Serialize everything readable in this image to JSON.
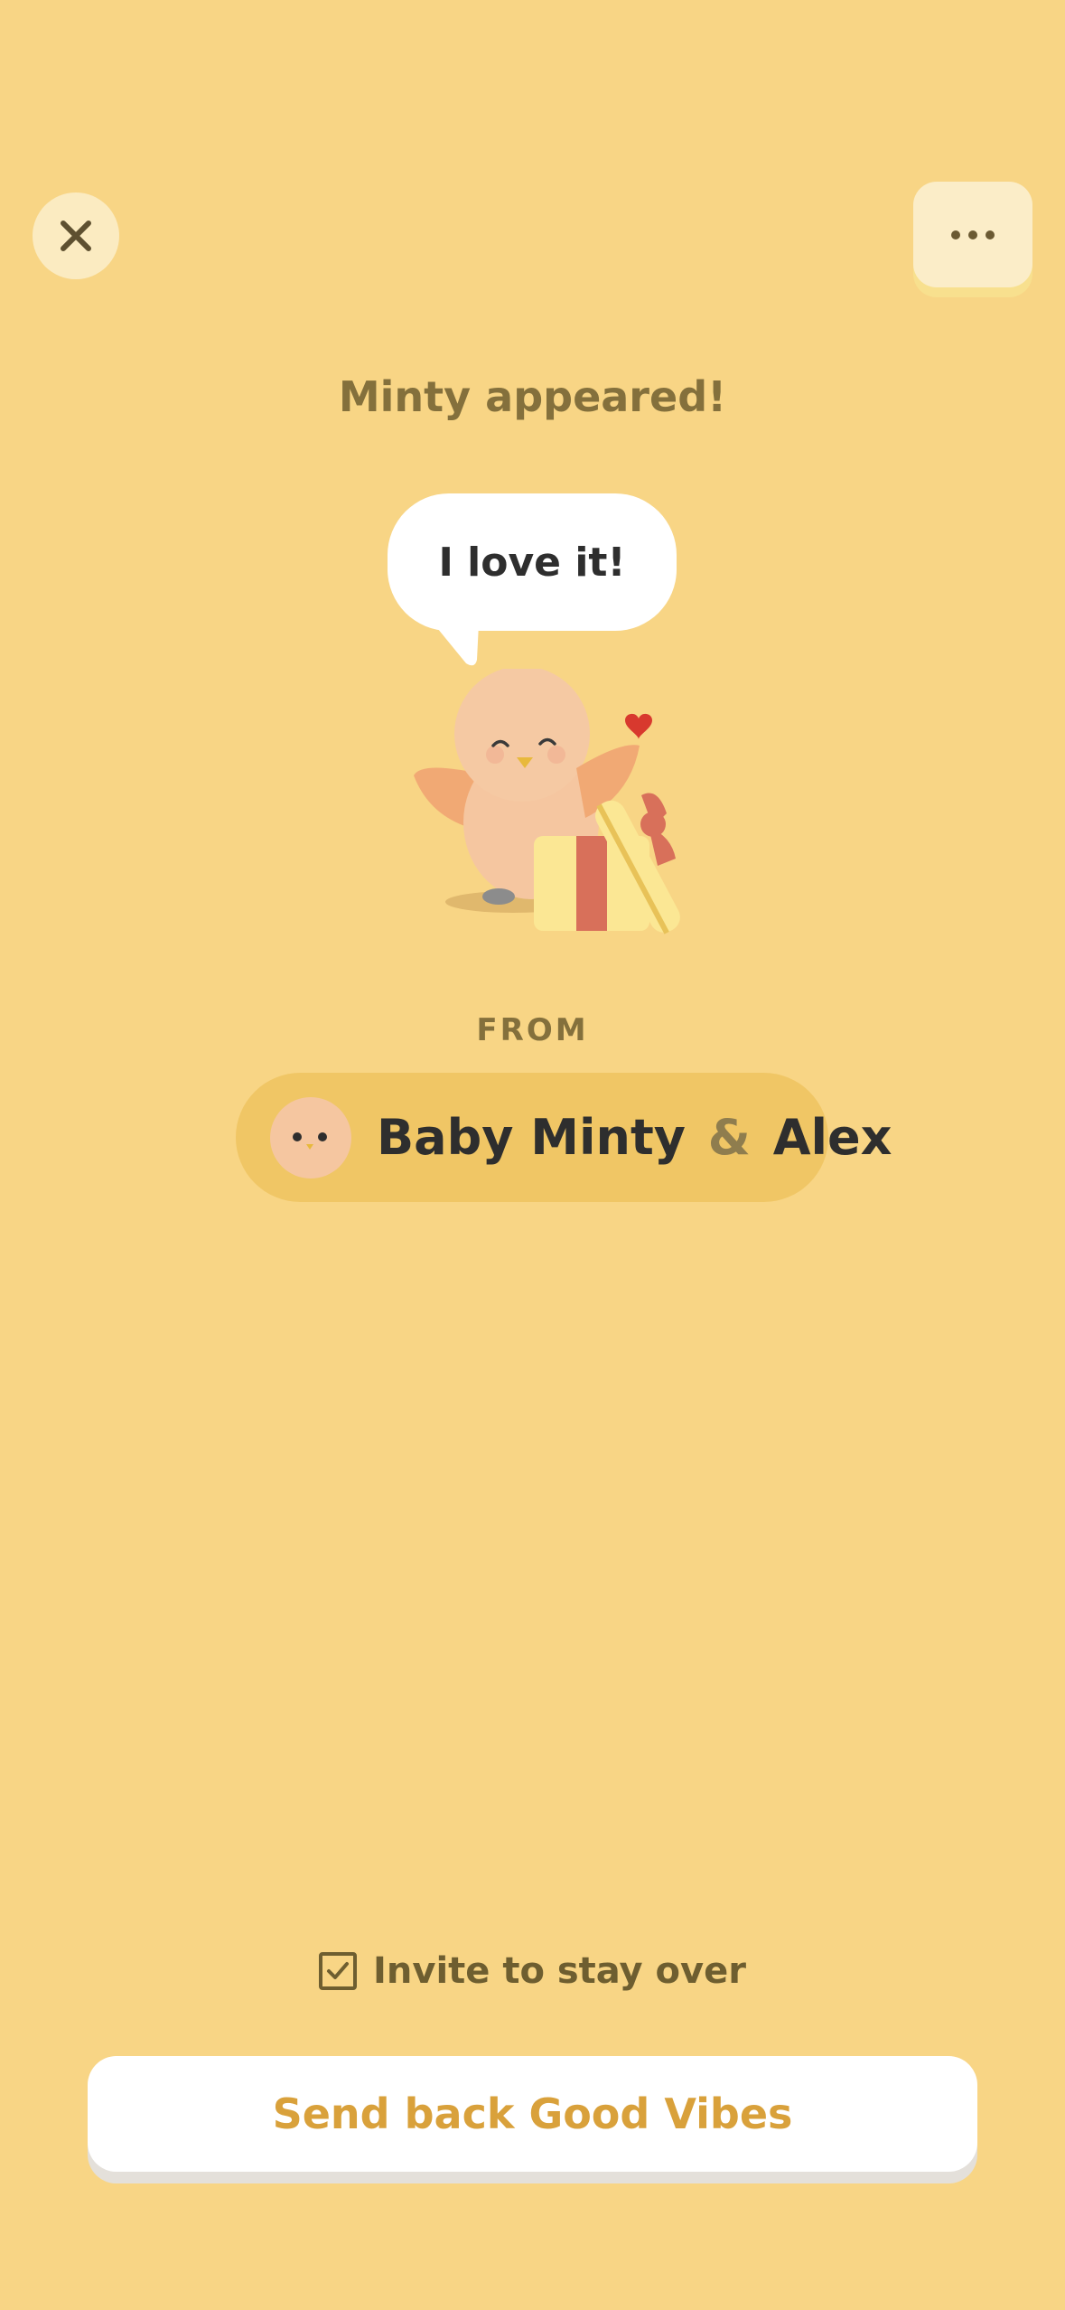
{
  "header": {
    "close_icon": "close-icon",
    "more_icon": "more-icon"
  },
  "title": "Minty appeared!",
  "speech_bubble": "I love it!",
  "illustration": {
    "icon": "mascot-gift-illustration"
  },
  "from_label": "FROM",
  "sender": {
    "name1": "Baby Minty",
    "amp": "&",
    "name2": "Alex"
  },
  "invite": {
    "label": "Invite to stay over",
    "checked": true
  },
  "cta": {
    "label": "Send back Good Vibes"
  },
  "colors": {
    "background": "#F8D585",
    "accent": "#D9A13B",
    "pill": "#F0C665",
    "text_dark": "#2E2E2E",
    "text_muted": "#84703C"
  }
}
